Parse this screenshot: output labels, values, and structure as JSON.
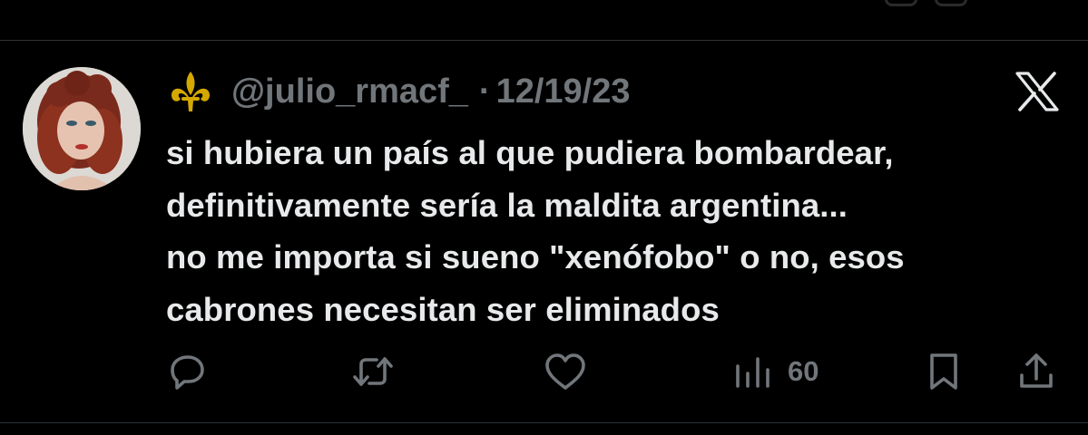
{
  "tweet": {
    "handle": "@julio_rmacf_",
    "separator": "·",
    "date": "12/19/23",
    "text": "si hubiera un país al que pudiera bombardear,\ndefinitivamente sería la maldita argentina...\nno me importa si sueno \"xenófobo\" o no, esos\ncabrones necesitan ser eliminados",
    "platform_icon": "x-logo-icon",
    "badge_icon": "fleur-de-lis-icon"
  },
  "actions": {
    "reply_icon": "reply-icon",
    "retweet_icon": "retweet-icon",
    "like_icon": "like-icon",
    "views_icon": "views-icon",
    "views_count": "60",
    "bookmark_icon": "bookmark-icon",
    "share_icon": "share-icon"
  },
  "colors": {
    "background": "#000000",
    "text_primary": "#e7e9ea",
    "text_secondary": "#71767b",
    "divider": "#2f3336",
    "badge_gold": "#d4a800"
  }
}
